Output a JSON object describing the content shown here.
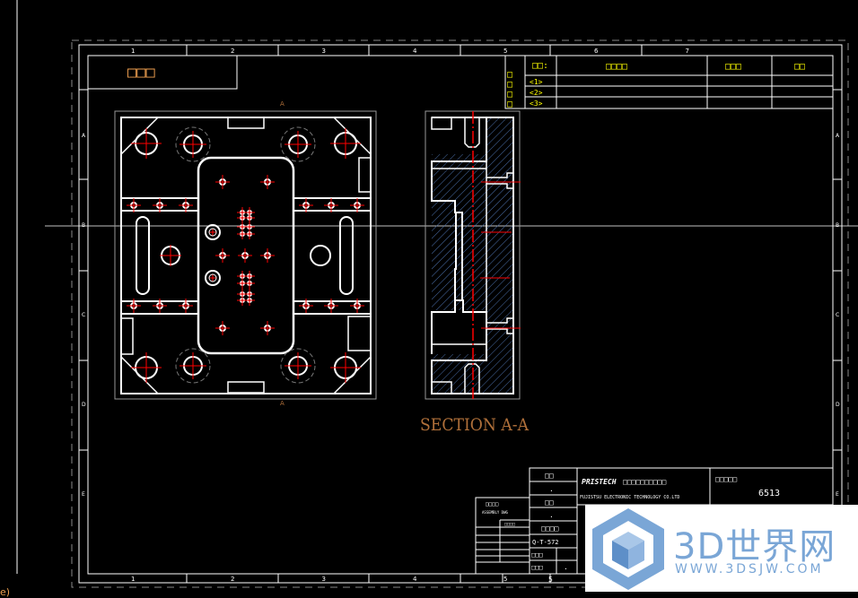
{
  "drawing": {
    "column_labels": [
      "1",
      "2",
      "3",
      "4",
      "5",
      "6",
      "7"
    ],
    "row_labels": [
      "A",
      "B",
      "C",
      "D",
      "E"
    ],
    "title_box_label": "□□□",
    "section_label": "SECTION A-A",
    "view_marker": "A",
    "bottom_sheet_number": "5"
  },
  "revision_table": {
    "side_label": "□□□□",
    "header": [
      "□□:",
      "□□□□",
      "□□□",
      "□□"
    ],
    "rows": [
      "<1>",
      "<2>",
      "<3>"
    ]
  },
  "title_block": {
    "left_cells": [
      "□□",
      "",
      "□□",
      "",
      "□□□□",
      "Q-T-572",
      "□□□",
      "□□□"
    ],
    "right_small": [
      ".",
      ".",
      "."
    ],
    "company_brand": "PRISTECH",
    "company_name_cn": "□□□□□□□□□□",
    "company_name_en": "FUJISTSU ELECTRONIC TECHNOLOGY CO.LTD",
    "drawing_no_label": "□□□□□",
    "drawing_no": "6513",
    "side_table": [
      "□□□□",
      "ASSEMBLY DWG",
      "□□□□",
      "",
      "",
      "",
      "",
      "",
      "",
      ""
    ]
  },
  "watermark": {
    "text": "3D世界网",
    "url": "WWW.3DSJW.COM"
  },
  "status": {
    "command_fragment": "e)"
  },
  "colors": {
    "background": "#000000",
    "lines": "#ffffff",
    "centerline": "#ff0000",
    "hidden": "#808080",
    "section_text": "#b0703a",
    "label": "#ffff00",
    "hatch": "#4a6ea8"
  }
}
